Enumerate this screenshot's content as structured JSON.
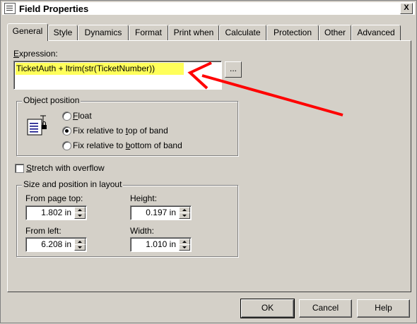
{
  "window": {
    "title": "Field Properties",
    "close_glyph": "X"
  },
  "tabs": [
    {
      "label": "General",
      "active": true
    },
    {
      "label": "Style"
    },
    {
      "label": "Dynamics"
    },
    {
      "label": "Format"
    },
    {
      "label": "Print when"
    },
    {
      "label": "Calculate"
    },
    {
      "label": "Protection"
    },
    {
      "label": "Other"
    },
    {
      "label": "Advanced"
    }
  ],
  "general": {
    "expression_label_u": "E",
    "expression_label_rest": "xpression:",
    "expression_value": "TicketAuth + ltrim(str(TicketNumber))",
    "ellipsis_label": "...",
    "object_position": {
      "title": "Object position",
      "options": [
        {
          "pre": "",
          "u": "F",
          "post": "loat",
          "selected": false
        },
        {
          "pre": "Fix relative to ",
          "u": "t",
          "post": "op of band",
          "selected": true
        },
        {
          "pre": "Fix relative to ",
          "u": "b",
          "post": "ottom of band",
          "selected": false
        }
      ]
    },
    "stretch": {
      "u": "S",
      "post": "tretch with overflow",
      "checked": false
    },
    "size_position": {
      "title": "Size and position in layout",
      "from_page_top": {
        "label": "From page top:",
        "value": "1.802 in"
      },
      "height": {
        "label": "Height:",
        "value": "0.197 in"
      },
      "from_left": {
        "label": "From left:",
        "value": "6.208 in"
      },
      "width": {
        "label": "Width:",
        "value": "1.010 in"
      }
    }
  },
  "buttons": {
    "ok": "OK",
    "cancel": "Cancel",
    "help": "Help"
  },
  "annotation": {
    "arrow_color": "#ff0000",
    "highlight_color": "#ffff5a"
  }
}
